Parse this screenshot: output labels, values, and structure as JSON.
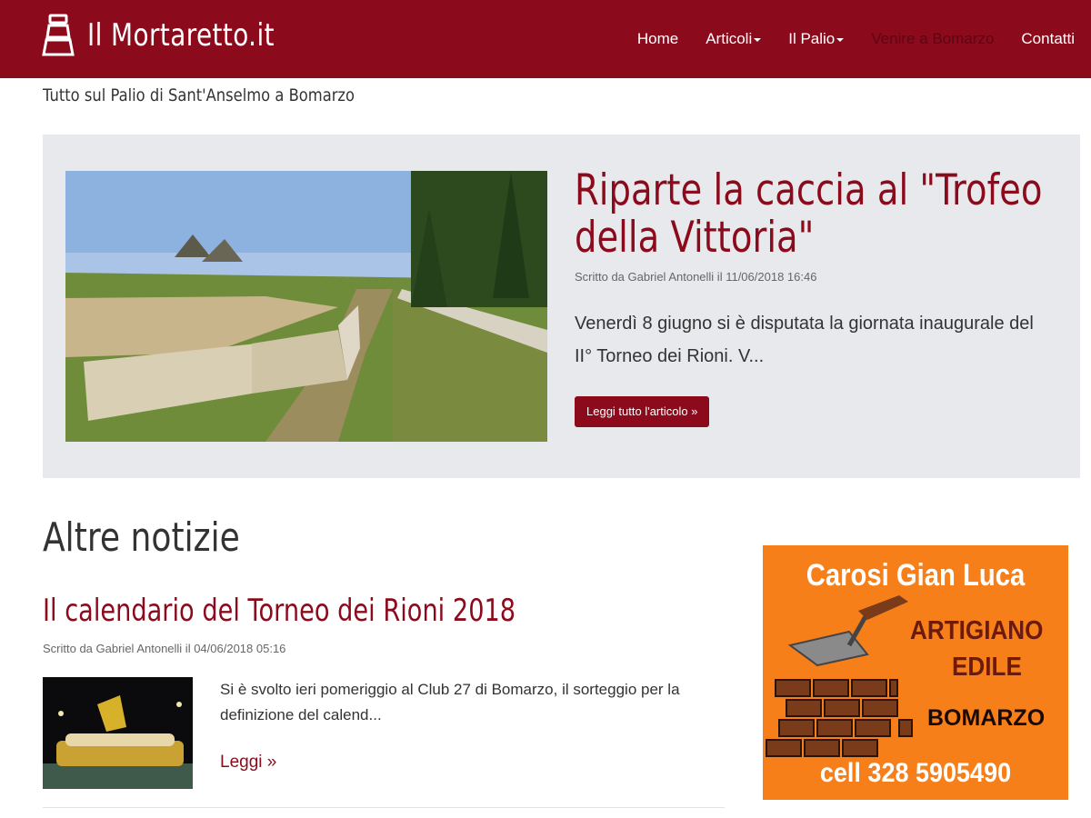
{
  "brand": {
    "name": "Il Mortaretto.it",
    "logo_icon": "mortar-icon"
  },
  "nav": {
    "items": [
      {
        "label": "Home",
        "dropdown": false
      },
      {
        "label": "Articoli",
        "dropdown": true
      },
      {
        "label": "Il Palio",
        "dropdown": true
      },
      {
        "label": "Venire a Bomarzo",
        "dropdown": false
      },
      {
        "label": "Contatti",
        "dropdown": false
      }
    ]
  },
  "tagline": "Tutto sul Palio di Sant'Anselmo a Bomarzo",
  "featured": {
    "title": "Riparte la caccia al \"Trofeo della Vittoria\"",
    "meta": "Scritto da Gabriel Antonelli il 11/06/2018 16:46",
    "excerpt": "Venerdì 8 giugno si è disputata la giornata inaugurale del II° Torneo dei Rioni. V...",
    "button": "Leggi tutto l'articolo »"
  },
  "news": {
    "section_title": "Altre notizie",
    "articles": [
      {
        "title": "Il calendario del Torneo dei Rioni 2018",
        "meta": "Scritto da Gabriel Antonelli il 04/06/2018 05:16",
        "excerpt": "Si è svolto ieri pomeriggio al Club 27 di Bomarzo, il sorteggio per la definizione del calend...",
        "more": "Leggi »"
      }
    ]
  },
  "ad": {
    "name": "Carosi Gian Luca",
    "trade_line1": "ARTIGIANO",
    "trade_line2": "EDILE",
    "town": "BOMARZO",
    "phone": "cell 328 5905490"
  },
  "colors": {
    "brand": "#8b0b1c",
    "featured_bg": "#e8e9ec",
    "ad_bg": "#f77f1a"
  }
}
